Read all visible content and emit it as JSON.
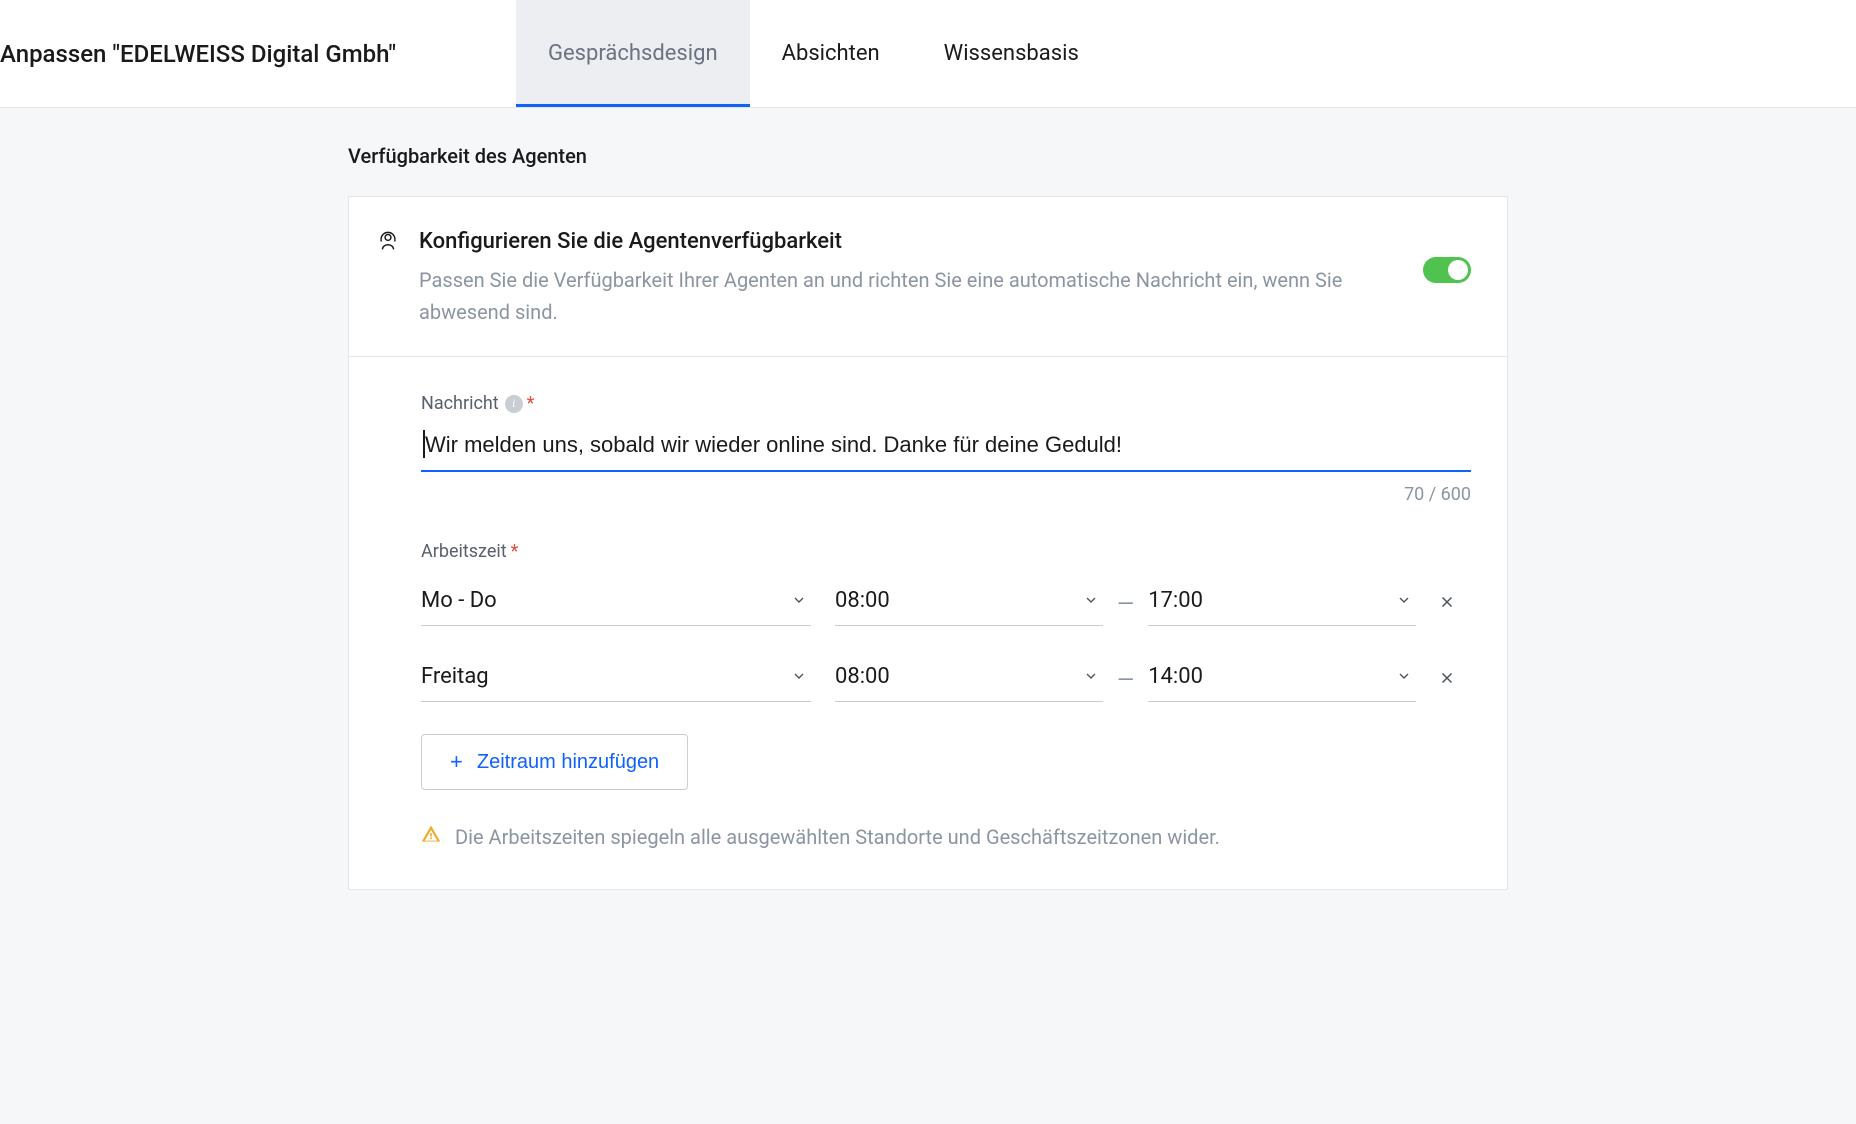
{
  "header": {
    "title": "Anpassen \"EDELWEISS Digital Gmbh\"",
    "tabs": [
      {
        "label": "Gesprächsdesign",
        "active": true
      },
      {
        "label": "Absichten",
        "active": false
      },
      {
        "label": "Wissensbasis",
        "active": false
      }
    ]
  },
  "section_title": "Verfügbarkeit des Agenten",
  "card": {
    "title": "Konfigurieren Sie die Agentenverfügbarkeit",
    "subtitle": "Passen Sie die Verfügbarkeit Ihrer Agenten an und richten Sie eine automatische Nachricht ein, wenn Sie abwesend sind.",
    "toggle_on": true
  },
  "message": {
    "label": "Nachricht",
    "value": "Wir melden uns, sobald wir wieder online sind. Danke für deine Geduld!",
    "counter": "70 / 600"
  },
  "hours": {
    "label": "Arbeitszeit",
    "rows": [
      {
        "day": "Mo - Do",
        "start": "08:00",
        "end": "17:00"
      },
      {
        "day": "Freitag",
        "start": "08:00",
        "end": "14:00"
      }
    ],
    "add_label": "Zeitraum hinzufügen",
    "warning": "Die Arbeitszeiten spiegeln alle ausgewählten Standorte und Geschäftszeitzonen wider."
  }
}
